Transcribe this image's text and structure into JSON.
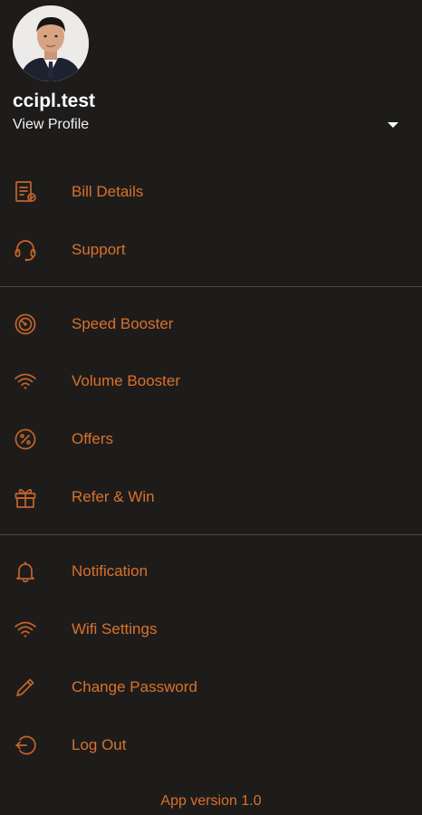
{
  "profile": {
    "username": "ccipl.test",
    "view_profile": "View Profile",
    "dropdown_icon": "caret-down-icon"
  },
  "menu": {
    "group1": [
      {
        "label": "Bill Details",
        "icon": "bill-icon"
      },
      {
        "label": "Support",
        "icon": "headset-icon"
      }
    ],
    "group2": [
      {
        "label": "Speed Booster",
        "icon": "speed-icon"
      },
      {
        "label": "Volume Booster",
        "icon": "wifi-icon"
      },
      {
        "label": "Offers",
        "icon": "percent-icon"
      },
      {
        "label": "Refer & Win",
        "icon": "gift-icon"
      }
    ],
    "group3": [
      {
        "label": "Notification",
        "icon": "bell-icon"
      },
      {
        "label": "Wifi Settings",
        "icon": "wifi-icon"
      },
      {
        "label": "Change Password",
        "icon": "pencil-icon"
      },
      {
        "label": "Log Out",
        "icon": "logout-icon"
      }
    ]
  },
  "footer": {
    "version": "App version 1.0"
  },
  "colors": {
    "background": "#1e1c1b",
    "accent": "#d8712b",
    "divider": "#4a4644",
    "text": "#ffffff"
  }
}
